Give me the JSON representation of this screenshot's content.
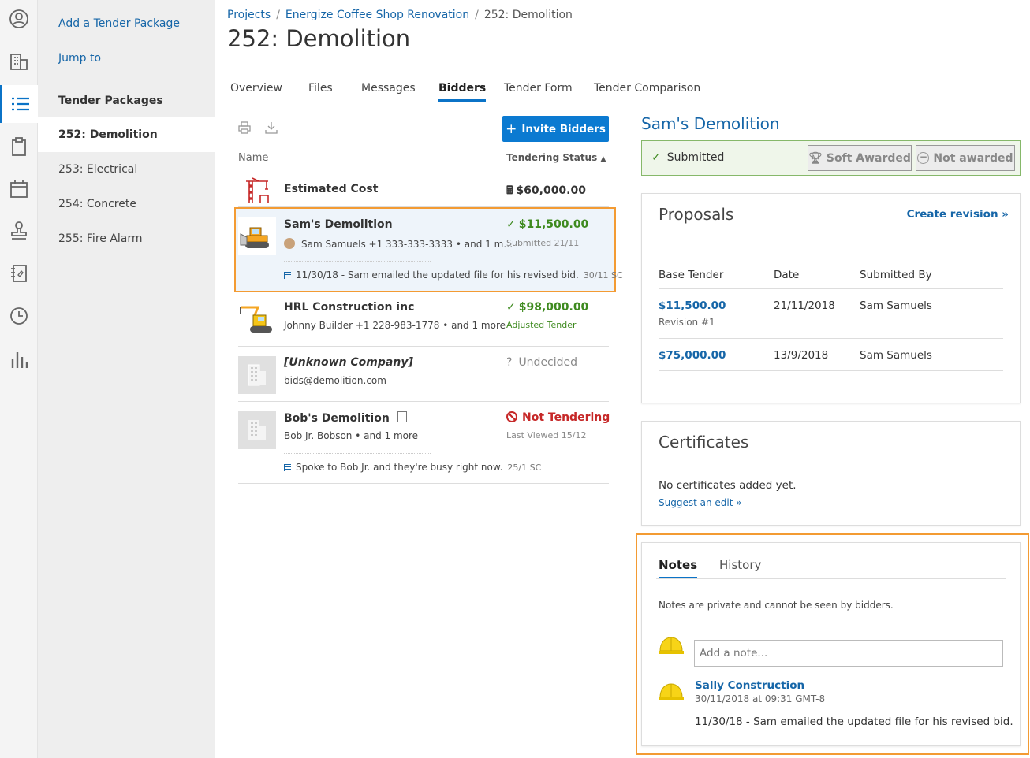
{
  "leftnav": {
    "add_link": "Add a Tender Package",
    "jump_link": "Jump to",
    "section_title": "Tender Packages",
    "items": [
      "252: Demolition",
      "253: Electrical",
      "254: Concrete",
      "255: Fire Alarm"
    ]
  },
  "breadcrumb": [
    "Projects",
    "Energize Coffee Shop Renovation",
    "252: Demolition"
  ],
  "page_title": "252: Demolition",
  "tabs": [
    "Overview",
    "Files",
    "Messages",
    "Bidders",
    "Tender Form",
    "Tender Comparison"
  ],
  "active_tab": "Bidders",
  "bidders_panel": {
    "invite_label": "Invite Bidders",
    "col_name": "Name",
    "col_status": "Tendering Status",
    "estimated": {
      "name": "Estimated Cost",
      "amount": "$60,000.00"
    },
    "rows": [
      {
        "name": "Sam's Demolition",
        "contact": "Sam Samuels +1 333-333-3333 • and 1 m…",
        "status": "$11,500.00",
        "substatus": "Submitted 21/11",
        "note": "11/30/18 - Sam emailed the updated file for his revised bid.",
        "note_date": "30/11 SC"
      },
      {
        "name": "HRL Construction inc",
        "contact": "Johnny Builder +1 228-983-1778 • and 1 more",
        "status": "$98,000.00",
        "substatus": "Adjusted Tender"
      },
      {
        "name": "[Unknown Company]",
        "contact": "bids@demolition.com",
        "status": "Undecided"
      },
      {
        "name": "Bob's Demolition",
        "contact": "Bob Jr. Bobson • and 1 more",
        "status": "Not Tendering",
        "substatus": "Last Viewed 15/12",
        "note": "Spoke to Bob Jr. and they're busy right now.",
        "note_date": "25/1 SC"
      }
    ]
  },
  "right_panel": {
    "title": "Sam's Demolition",
    "status": {
      "submitted": "Submitted",
      "soft_awarded": "Soft Awarded",
      "not_awarded": "Not awarded"
    },
    "proposals": {
      "title": "Proposals",
      "create_revision": "Create revision »",
      "headers": [
        "Base Tender",
        "Date",
        "Submitted By"
      ],
      "rows": [
        {
          "amount": "$11,500.00",
          "revision": "Revision #1",
          "date": "21/11/2018",
          "by": "Sam Samuels"
        },
        {
          "amount": "$75,000.00",
          "date": "13/9/2018",
          "by": "Sam Samuels"
        }
      ]
    },
    "certificates": {
      "title": "Certificates",
      "empty": "No certificates added yet.",
      "suggest": "Suggest an edit »"
    },
    "notes": {
      "tabs": [
        "Notes",
        "History"
      ],
      "privacy": "Notes are private and cannot be seen by bidders.",
      "placeholder": "Add a note...",
      "entry": {
        "author": "Sally Construction",
        "timestamp": "30/11/2018 at 09:31 GMT-8",
        "text": "11/30/18 - Sam emailed the updated file for his revised bid."
      }
    }
  },
  "colors": {
    "accent": "#0b73c7",
    "link": "#1666a8",
    "success": "#3e8a1f",
    "danger": "#c62828",
    "highlight": "#f39b33"
  }
}
